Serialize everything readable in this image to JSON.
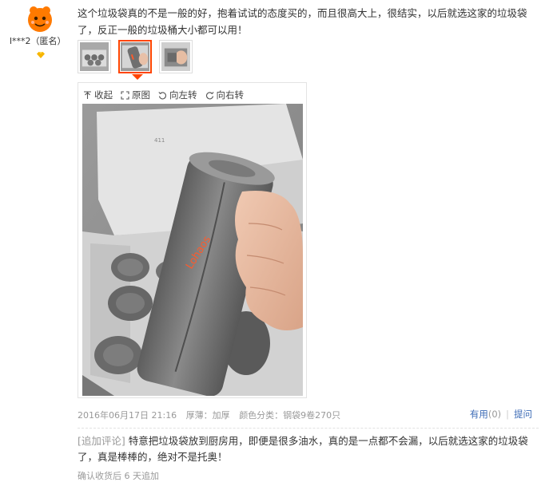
{
  "user": {
    "name": "l***2（匿名）",
    "avatar_color": "#ff6a00"
  },
  "review": {
    "text": "这个垃圾袋真的不是一般的好，抱着试试的态度买的，而且很高大上，很结实，以后就选这家的垃圾袋了，反正一般的垃圾桶大小都可以用！",
    "thumbnails": [
      {
        "name": "photo-1-box-overview"
      },
      {
        "name": "photo-2-bag-roll-in-hand"
      },
      {
        "name": "photo-3-bag-closeup"
      }
    ],
    "active_thumbnail": 1
  },
  "viewer": {
    "toolbar": {
      "collapse": "收起",
      "original": "原图",
      "rotate_left": "向左转",
      "rotate_right": "向右转"
    },
    "photo_brand_print": "Lohaos",
    "accent_color": "#ff4400"
  },
  "meta": {
    "date": "2016年06月17日 21:16",
    "thickness": "厚薄：加厚",
    "color_class": "颜色分类：钢袋9卷270只"
  },
  "actions": {
    "helpful": "有用",
    "helpful_count": "(0)",
    "ask": "提问",
    "link_color": "#3c6bb6"
  },
  "followup": {
    "tag": "[追加评论]",
    "text": "特意把垃圾袋放到厨房用，即便是很多油水，真的是一点都不会漏，以后就选这家的垃圾袋了，真是棒棒的，绝对不是托奥！",
    "time": "确认收货后 6 天追加"
  }
}
